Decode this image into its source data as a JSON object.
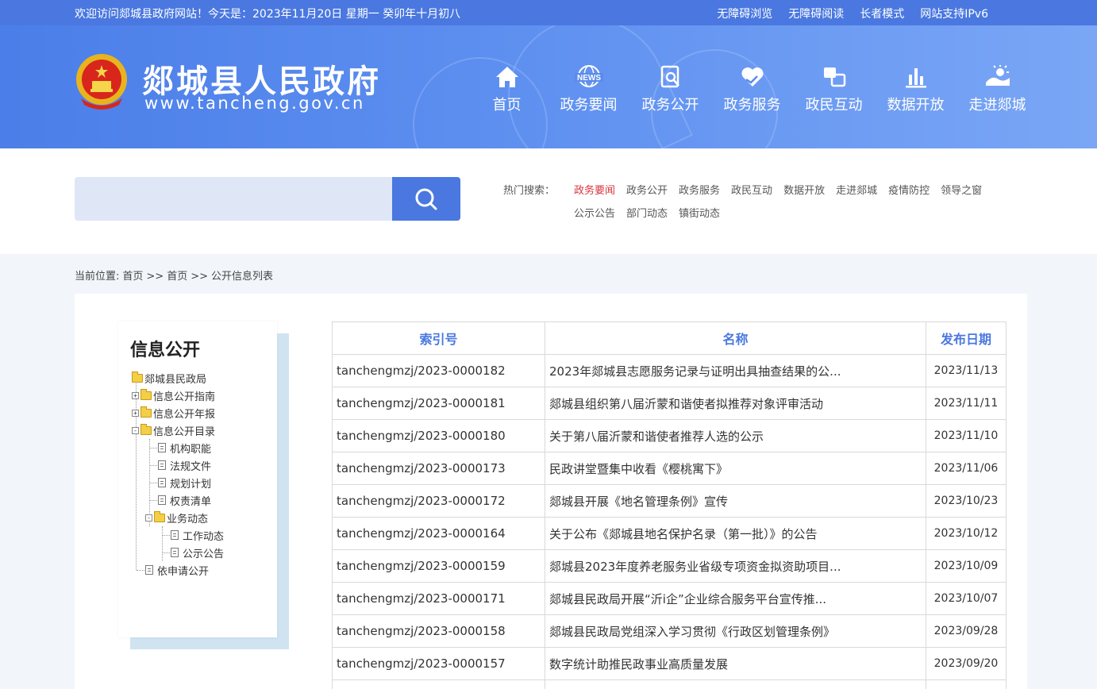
{
  "topbar": {
    "welcome": "欢迎访问郯城县政府网站！今天是：2023年11月20日  星期一  癸卯年十月初八",
    "links": [
      "无障碍浏览",
      "无障碍阅读",
      "长者模式",
      "网站支持IPv6"
    ]
  },
  "header": {
    "title": "郯城县人民政府",
    "url": "www.tancheng.gov.cn",
    "nav": [
      {
        "label": "首页",
        "icon": "home-icon"
      },
      {
        "label": "政务要闻",
        "icon": "news-icon",
        "icon_text": "NEWS"
      },
      {
        "label": "政务公开",
        "icon": "document-search-icon"
      },
      {
        "label": "政务服务",
        "icon": "heart-hand-icon"
      },
      {
        "label": "政民互动",
        "icon": "chat-icon"
      },
      {
        "label": "数据开放",
        "icon": "bar-chart-icon"
      },
      {
        "label": "走进郯城",
        "icon": "landscape-icon"
      }
    ]
  },
  "search": {
    "placeholder": "",
    "hot_label": "热门搜索：",
    "hot_items": [
      "政务要闻",
      "政务公开",
      "政务服务",
      "政民互动",
      "数据开放",
      "走进郯城",
      "疫情防控",
      "领导之窗",
      "公示公告",
      "部门动态",
      "镇街动态"
    ],
    "accent_color": "#4a78e0",
    "active_color": "#d9353e"
  },
  "breadcrumb": {
    "prefix": "当前位置:",
    "items": [
      "首页",
      "首页",
      "公开信息列表"
    ],
    "separator": ">>"
  },
  "sidebar": {
    "title": "信息公开",
    "tree": [
      {
        "label": "郯城县民政局"
      },
      {
        "label": "信息公开指南"
      },
      {
        "label": "信息公开年报"
      },
      {
        "label": "信息公开目录"
      },
      {
        "label": "机构职能"
      },
      {
        "label": "法规文件"
      },
      {
        "label": "规划计划"
      },
      {
        "label": "权责清单"
      },
      {
        "label": "业务动态"
      },
      {
        "label": "工作动态"
      },
      {
        "label": "公示公告"
      },
      {
        "label": "依申请公开"
      }
    ]
  },
  "table": {
    "headers": [
      "索引号",
      "名称",
      "发布日期"
    ],
    "rows": [
      {
        "idx": "tanchengmzj/2023-0000182",
        "name": "2023年郯城县志愿服务记录与证明出具抽查结果的公...",
        "date": "2023/11/13"
      },
      {
        "idx": "tanchengmzj/2023-0000181",
        "name": "郯城县组织第八届沂蒙和谐使者拟推荐对象评审活动",
        "date": "2023/11/11"
      },
      {
        "idx": "tanchengmzj/2023-0000180",
        "name": "关于第八届沂蒙和谐使者推荐人选的公示",
        "date": "2023/11/10"
      },
      {
        "idx": "tanchengmzj/2023-0000173",
        "name": "民政讲堂暨集中收看《樱桃寓下》",
        "date": "2023/11/06"
      },
      {
        "idx": "tanchengmzj/2023-0000172",
        "name": "郯城县开展《地名管理条例》宣传",
        "date": "2023/10/23"
      },
      {
        "idx": "tanchengmzj/2023-0000164",
        "name": "关于公布《郯城县地名保护名录（第一批）》的公告",
        "date": "2023/10/12"
      },
      {
        "idx": "tanchengmzj/2023-0000159",
        "name": "郯城县2023年度养老服务业省级专项资金拟资助项目...",
        "date": "2023/10/09"
      },
      {
        "idx": "tanchengmzj/2023-0000171",
        "name": "郯城县民政局开展“沂i企”企业综合服务平台宣传推...",
        "date": "2023/10/07"
      },
      {
        "idx": "tanchengmzj/2023-0000158",
        "name": "郯城县民政局党组深入学习贯彻《行政区划管理条例》",
        "date": "2023/09/28"
      },
      {
        "idx": "tanchengmzj/2023-0000157",
        "name": "数字统计助推民政事业高质量发展",
        "date": "2023/09/20"
      },
      {
        "idx": "",
        "name": "",
        "date": ""
      }
    ]
  }
}
